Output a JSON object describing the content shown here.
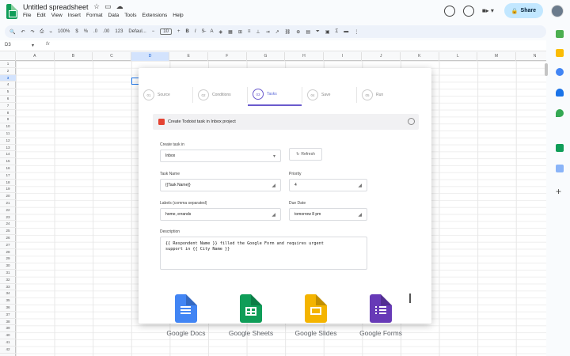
{
  "app": {
    "title": "Untitled spreadsheet",
    "menus": [
      "File",
      "Edit",
      "View",
      "Insert",
      "Format",
      "Data",
      "Tools",
      "Extensions",
      "Help"
    ],
    "share_label": "Share"
  },
  "toolbar": {
    "zoom": "100%",
    "currency": "$",
    "percent": "%",
    "dec_dec": ".0",
    "dec_inc": ".00",
    "format_123": "123",
    "font": "Defaul...",
    "font_size": "10",
    "bold": "B",
    "italic": "I"
  },
  "formula": {
    "name_box": "D3",
    "fx": "fx"
  },
  "columns": [
    "A",
    "B",
    "C",
    "D",
    "E",
    "F",
    "G",
    "H",
    "I",
    "J",
    "K",
    "L",
    "M",
    "N"
  ],
  "selected_column": "D",
  "selected_row": "3",
  "modal": {
    "steps": [
      {
        "num": "01",
        "label": "Source"
      },
      {
        "num": "02",
        "label": "Conditions"
      },
      {
        "num": "03",
        "label": "Tasks"
      },
      {
        "num": "04",
        "label": "Save"
      },
      {
        "num": "05",
        "label": "Run"
      }
    ],
    "active_step": 2,
    "task_header": "Create Todoist task in Inbox project",
    "create_task_in_label": "Create task in",
    "create_task_in_value": "Inbox",
    "refresh_label": "Refresh",
    "task_name_label": "Task Name",
    "task_name_value": "{{Task Name}}",
    "priority_label": "Priority",
    "priority_value": "4",
    "labels_label": "Labels (comma separated)",
    "labels_value": "home, errands",
    "due_date_label": "Due Date",
    "due_date_value": "tomorrow 8 pm",
    "description_label": "Description",
    "description_line1": "{{ Respondent Name }} filled the Google Form and requires urgent",
    "description_line2": "support in {{ City Name }}"
  },
  "products": [
    {
      "name": "Google Docs",
      "color": "#4285f4"
    },
    {
      "name": "Google Sheets",
      "color": "#0f9d58"
    },
    {
      "name": "Google Slides",
      "color": "#f4b400"
    },
    {
      "name": "Google Forms",
      "color": "#673ab7"
    }
  ]
}
